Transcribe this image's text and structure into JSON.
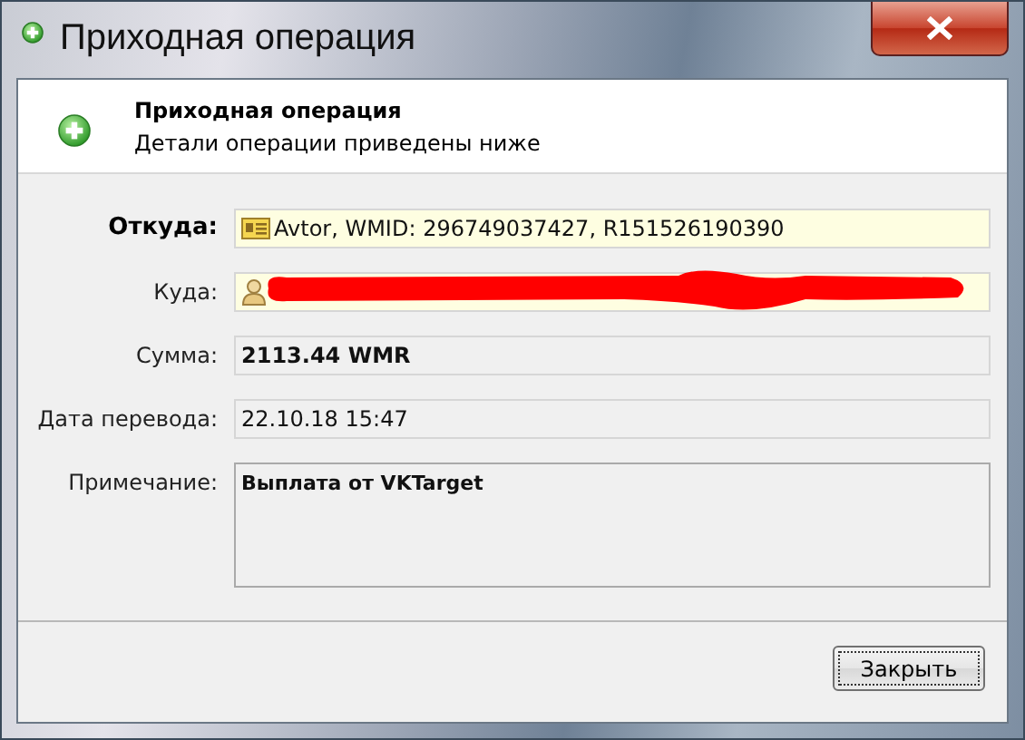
{
  "window": {
    "title": "Приходная операция"
  },
  "header": {
    "title": "Приходная операция",
    "subtitle": "Детали операции приведены ниже"
  },
  "fields": [
    {
      "kind": "card",
      "label": "Откуда:",
      "label_bold": true,
      "value": "Avtor, WMID: 296749037427, R151526190390",
      "value_bold": false,
      "redacted": false
    },
    {
      "kind": "person",
      "label": "Куда:",
      "label_bold": false,
      "redacted": true
    },
    {
      "kind": "plain",
      "label": "Сумма:",
      "label_bold": false,
      "value": "2113.44 WMR",
      "value_bold": true,
      "redacted": false
    },
    {
      "kind": "plain",
      "label": "Дата перевода:",
      "label_bold": false,
      "value": "22.10.18 15:47",
      "value_bold": false,
      "redacted": false
    },
    {
      "kind": "memo",
      "label": "Примечание:",
      "label_bold": false,
      "value": "Выплата от VKTarget",
      "value_bold": true,
      "redacted": false
    }
  ],
  "buttons": [
    {
      "label": "Закрыть",
      "focused": true
    }
  ]
}
